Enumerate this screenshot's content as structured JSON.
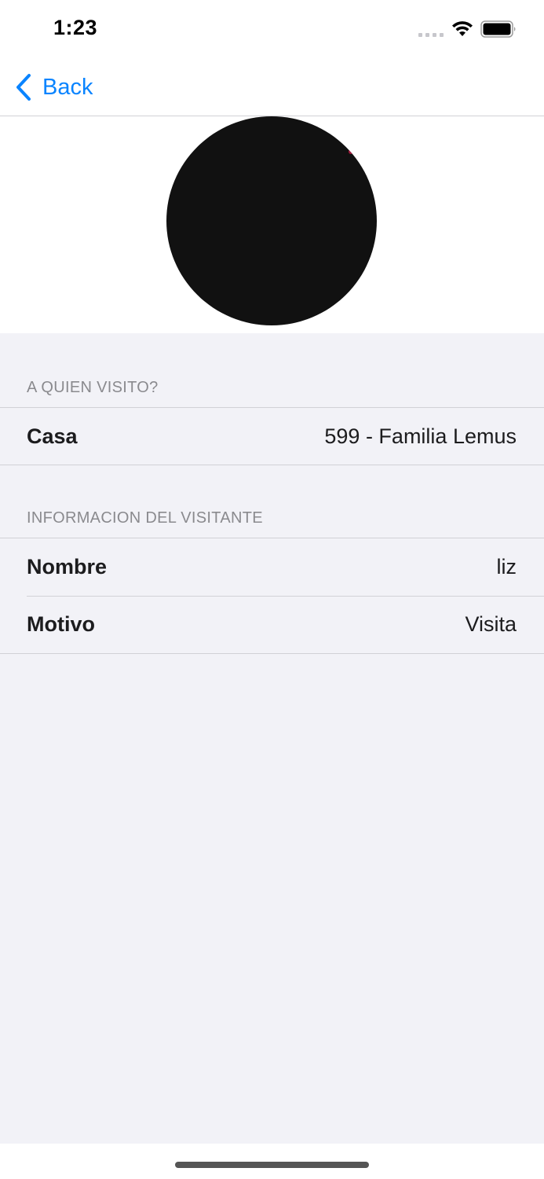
{
  "status_bar": {
    "time": "1:23",
    "icons": [
      "signal-icon",
      "wifi-icon",
      "battery-icon"
    ]
  },
  "nav": {
    "back_label": "Back",
    "back_icon": "chevron-left-icon",
    "accent_color": "#0a84ff"
  },
  "photo": {
    "icon": "avatar-photo"
  },
  "sections": [
    {
      "header": "A QUIEN VISITO?",
      "rows": [
        {
          "label": "Casa",
          "value": "599 - Familia Lemus"
        }
      ]
    },
    {
      "header": "INFORMACION DEL VISITANTE",
      "rows": [
        {
          "label": "Nombre",
          "value": "liz"
        },
        {
          "label": "Motivo",
          "value": "Visita"
        }
      ]
    }
  ]
}
